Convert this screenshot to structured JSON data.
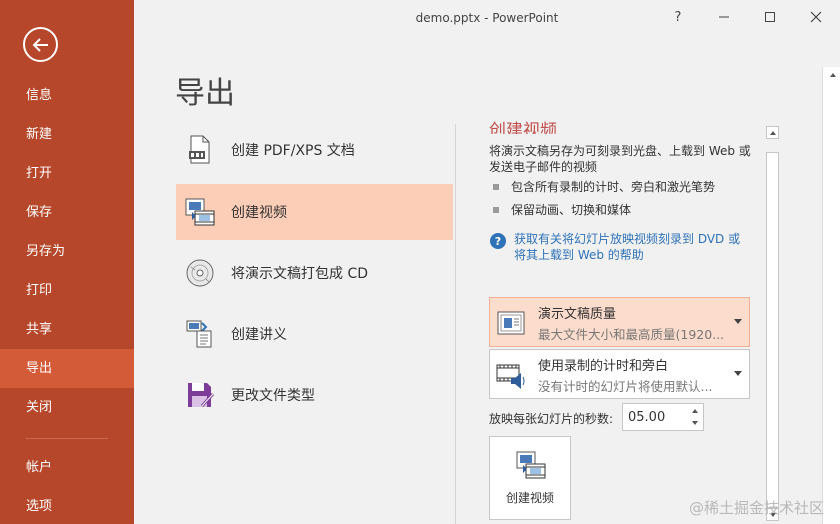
{
  "window": {
    "title": "demo.pptx - PowerPoint",
    "help_label": "?",
    "minimize_label": "—",
    "maximize_label": "☐",
    "close_label": "✕"
  },
  "sidebar": {
    "accent": "#b7472a",
    "active_color": "#d35b38",
    "items": [
      {
        "label": "信息"
      },
      {
        "label": "新建"
      },
      {
        "label": "打开"
      },
      {
        "label": "保存"
      },
      {
        "label": "另存为"
      },
      {
        "label": "打印"
      },
      {
        "label": "共享"
      },
      {
        "label": "导出",
        "active": true
      },
      {
        "label": "关闭"
      },
      {
        "label": "帐户"
      },
      {
        "label": "选项"
      }
    ]
  },
  "page": {
    "title": "导出"
  },
  "options": [
    {
      "label": "创建 PDF/XPS 文档",
      "icon": "pdf-document-icon"
    },
    {
      "label": "创建视频",
      "icon": "video-icon",
      "selected": true
    },
    {
      "label": "将演示文稿打包成 CD",
      "icon": "cd-icon"
    },
    {
      "label": "创建讲义",
      "icon": "handout-icon"
    },
    {
      "label": "更改文件类型",
      "icon": "save-file-type-icon"
    }
  ],
  "panel": {
    "heading": "创建视频",
    "description": "将演示文稿另存为可刻录到光盘、上载到 Web 或发送电子邮件的视频",
    "bullets": [
      "包含所有录制的计时、旁白和激光笔势",
      "保留动画、切换和媒体"
    ],
    "help_link": "获取有关将幻灯片放映视频刻录到 DVD 或将其上载到 Web 的帮助",
    "quality": {
      "title": "演示文稿质量",
      "subtitle": "最大文件大小和最高质量(1920..."
    },
    "timing": {
      "title": "使用录制的计时和旁白",
      "subtitle": "没有计时的幻灯片将使用默认..."
    },
    "seconds_label": "放映每张幻灯片的秒数:",
    "seconds_value": "05.00",
    "create_button": "创建视频"
  },
  "watermark": "@稀土掘金技术社区"
}
